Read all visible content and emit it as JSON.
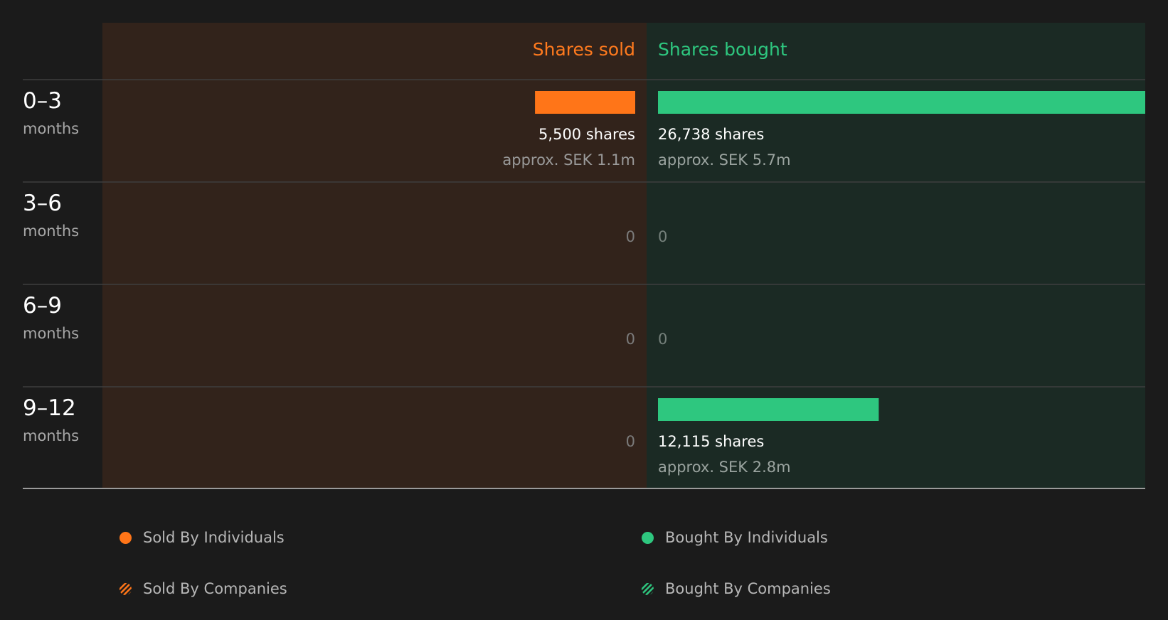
{
  "chart_data": {
    "type": "bar",
    "columns": {
      "sold_label": "Shares sold",
      "bought_label": "Shares bought"
    },
    "categories": [
      {
        "range": "0–3",
        "unit": "months"
      },
      {
        "range": "3–6",
        "unit": "months"
      },
      {
        "range": "6–9",
        "unit": "months"
      },
      {
        "range": "9–12",
        "unit": "months"
      }
    ],
    "series": [
      {
        "name": "Shares sold",
        "values": [
          5500,
          0,
          0,
          0
        ],
        "labels": [
          "5,500 shares",
          "0",
          "0",
          "0"
        ],
        "approx": [
          "approx. SEK 1.1m",
          "",
          "",
          ""
        ]
      },
      {
        "name": "Shares bought",
        "values": [
          26738,
          0,
          0,
          12115
        ],
        "labels": [
          "26,738 shares",
          "0",
          "0",
          "12,115 shares"
        ],
        "approx": [
          "approx. SEK 5.7m",
          "",
          "",
          "approx. SEK 2.8m"
        ]
      }
    ],
    "legend": [
      {
        "label": "Sold By Individuals",
        "style": "solid",
        "color": "#ff7518"
      },
      {
        "label": "Bought By Individuals",
        "style": "solid",
        "color": "#2ec77f"
      },
      {
        "label": "Sold By Companies",
        "style": "hatched",
        "color": "#ff7518"
      },
      {
        "label": "Bought By Companies",
        "style": "hatched",
        "color": "#2ec77f"
      }
    ],
    "colors": {
      "sold": "#ff7518",
      "bought": "#2ec77f",
      "sold_bg": "#32231b",
      "bought_bg": "#1b2a24",
      "background": "#1b1b1b"
    }
  }
}
